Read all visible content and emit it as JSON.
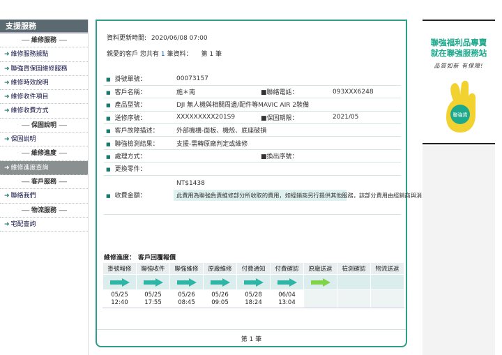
{
  "sidebar": {
    "header": "支援服務",
    "items": [
      {
        "type": "section",
        "label": "維修服務"
      },
      {
        "type": "link",
        "label": "維修服務據點"
      },
      {
        "type": "link",
        "label": "聯強貨保固維修服務"
      },
      {
        "type": "link",
        "label": "維修時效說明"
      },
      {
        "type": "link",
        "label": "維修收件項目"
      },
      {
        "type": "link",
        "label": "維修收費方式"
      },
      {
        "type": "section",
        "label": "保固說明"
      },
      {
        "type": "link",
        "label": "保固說明"
      },
      {
        "type": "section",
        "label": "維修進度"
      },
      {
        "type": "link",
        "label": "維修進度查詢",
        "active": true
      },
      {
        "type": "section",
        "label": "客戶服務"
      },
      {
        "type": "link",
        "label": "聯絡我們"
      },
      {
        "type": "section",
        "label": "物流服務"
      },
      {
        "type": "link",
        "label": "宅配查詢"
      }
    ],
    "section_dash": "-----"
  },
  "main": {
    "update_label": "資料更新時間:",
    "update_time": "2020/06/08 07:00",
    "count_prefix": "親愛的客戶 您共有",
    "count_n": "1",
    "count_mid": "筆資料：",
    "count_page": "第 1 筆",
    "detail": {
      "order_no_label": "掛號單號：",
      "order_no": "00073157",
      "customer_label": "客戶名稱：",
      "customer": "施＊南",
      "phone_label": "聯絡電話：",
      "phone": "093XXX6248",
      "product_label": "產品型號：",
      "product": "DJI 無人機與相關周邊/配件等MAVIC AIR 2裝備",
      "serial_label": "送修序號：",
      "serial": "XXXXXXXXX201S9",
      "warranty_label": "保固期限：",
      "warranty": "2021/05",
      "fault_label": "客戶故障描述：",
      "fault": "外部機構-面板、機殼、底座破損",
      "check_label": "聯強檢測結果：",
      "check": "支援-需轉原廠判定或維修",
      "method_label": "處理方式：",
      "method": "",
      "swap_label": "換出序號：",
      "swap": "",
      "parts_label": "更換零件：",
      "parts": "",
      "fee_label": "收費金額：",
      "fee": "NT$1438",
      "fee_note": "此費用為聯強負責維修部分所收取的費用，如經銷商另行提供其他服務，該部分費用由經銷商與消費者自行議定。"
    },
    "progress_title": "維修進度：",
    "progress_status": "客戶回覆報價",
    "steps": [
      {
        "label": "掛號報修",
        "date": "05/25",
        "time": "12:40",
        "arrow": "done"
      },
      {
        "label": "聯強收件",
        "date": "05/25",
        "time": "17:55",
        "arrow": "done"
      },
      {
        "label": "聯強維修",
        "date": "05/26",
        "time": "08:45",
        "arrow": "done"
      },
      {
        "label": "原廠維修",
        "date": "05/26",
        "time": "09:05",
        "arrow": "done"
      },
      {
        "label": "付費通知",
        "date": "05/28",
        "time": "18:24",
        "arrow": "done"
      },
      {
        "label": "付費確認",
        "date": "06/04",
        "time": "13:04",
        "arrow": "done"
      },
      {
        "label": "原廠送返",
        "date": "",
        "time": "",
        "arrow": "current"
      },
      {
        "label": "檢測確認",
        "date": "",
        "time": "",
        "arrow": "none"
      },
      {
        "label": "物流送返",
        "date": "",
        "time": "",
        "arrow": "none"
      }
    ],
    "footer_page": "第 1 筆"
  },
  "ad": {
    "line1": "聯強福利品專賣",
    "line2": "就在聯強服務站",
    "line3": "品質如新 有保障!",
    "badge": "聯強貨"
  },
  "colors": {
    "accent": "#2f9e88",
    "arrow_done": "#2fb5a5",
    "arrow_current": "#7fd44a",
    "ad_green": "#1ea88c",
    "hand_yellow": "#f2d230"
  }
}
